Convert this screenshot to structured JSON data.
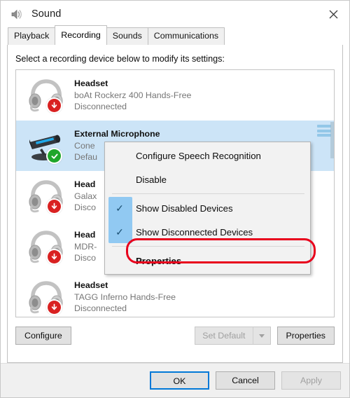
{
  "window": {
    "title": "Sound",
    "title_icon": "speaker-icon",
    "close_label": "✕"
  },
  "tabs": [
    {
      "label": "Playback",
      "active": false
    },
    {
      "label": "Recording",
      "active": true
    },
    {
      "label": "Sounds",
      "active": false
    },
    {
      "label": "Communications",
      "active": false
    }
  ],
  "main": {
    "instruction": "Select a recording device below to modify its settings:"
  },
  "devices": [
    {
      "name": "Headset",
      "desc": "boAt Rockerz 400 Hands-Free",
      "status": "Disconnected",
      "icon": "headset-icon",
      "badge": "red-down-arrow",
      "selected": false
    },
    {
      "name": "External Microphone",
      "desc": "Cone",
      "status": "Defau",
      "icon": "microphone-icon",
      "badge": "green-check",
      "selected": true
    },
    {
      "name": "Head",
      "desc": "Galax",
      "status": "Disco",
      "icon": "headset-icon",
      "badge": "red-down-arrow",
      "selected": false
    },
    {
      "name": "Head",
      "desc": "MDR-",
      "status": "Disco",
      "icon": "headset-icon",
      "badge": "red-down-arrow",
      "selected": false
    },
    {
      "name": "Headset",
      "desc": "TAGG Inferno Hands-Free",
      "status": "Disconnected",
      "icon": "headset-icon",
      "badge": "red-down-arrow",
      "selected": false
    }
  ],
  "context_menu": {
    "items": [
      {
        "label": "Configure Speech Recognition",
        "checked": false,
        "bold": false
      },
      {
        "label": "Disable",
        "checked": false,
        "bold": false
      },
      {
        "label": "Show Disabled Devices",
        "checked": true,
        "bold": false
      },
      {
        "label": "Show Disconnected Devices",
        "checked": true,
        "bold": false
      },
      {
        "label": "Properties",
        "checked": false,
        "bold": true
      }
    ],
    "check_glyph": "✓",
    "highlight_color": "#91c9f2"
  },
  "annotation": {
    "shape": "red-ellipse",
    "color": "#e8001c",
    "target": "Properties"
  },
  "action_buttons": {
    "configure": "Configure",
    "set_default": "Set Default",
    "set_default_disabled": true,
    "properties": "Properties"
  },
  "footer_buttons": {
    "ok": "OK",
    "cancel": "Cancel",
    "apply": "Apply",
    "apply_disabled": true
  }
}
